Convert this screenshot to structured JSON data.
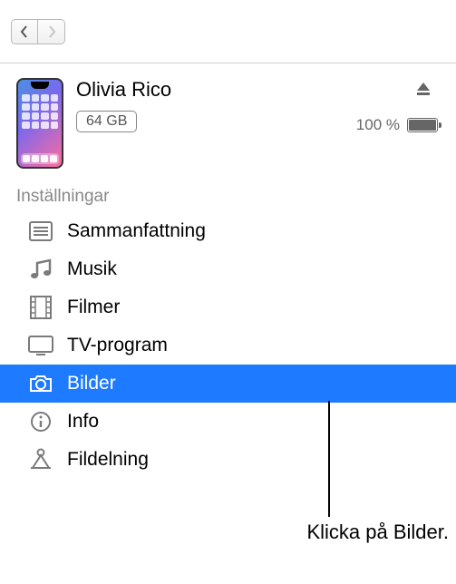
{
  "device": {
    "name": "Olivia Rico",
    "storage": "64 GB",
    "battery_percent": "100 %"
  },
  "sidebar": {
    "header": "Inställningar",
    "items": [
      {
        "label": "Sammanfattning",
        "icon": "list",
        "selected": false
      },
      {
        "label": "Musik",
        "icon": "music",
        "selected": false
      },
      {
        "label": "Filmer",
        "icon": "film",
        "selected": false
      },
      {
        "label": "TV-program",
        "icon": "tv",
        "selected": false
      },
      {
        "label": "Bilder",
        "icon": "camera",
        "selected": true
      },
      {
        "label": "Info",
        "icon": "info",
        "selected": false
      },
      {
        "label": "Fildelning",
        "icon": "apps",
        "selected": false
      }
    ]
  },
  "callout": "Klicka på Bilder."
}
